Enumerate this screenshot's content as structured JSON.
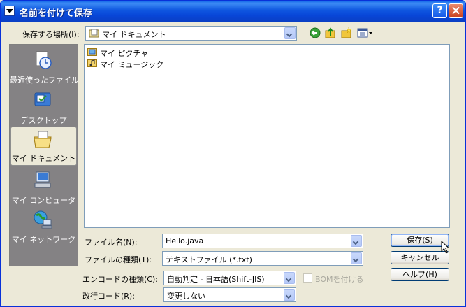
{
  "window": {
    "title": "名前を付けて保存",
    "help_glyph": "?"
  },
  "location": {
    "label": "保存する場所(I):",
    "value": "マイ ドキュメント"
  },
  "toolbar": {
    "back_icon": "back-arrow-icon",
    "up_icon": "up-folder-icon",
    "new_folder_icon": "new-folder-icon",
    "views_icon": "views-menu-icon"
  },
  "places": [
    {
      "label": "最近使ったファイル",
      "icon": "recent-files-icon",
      "selected": false
    },
    {
      "label": "デスクトップ",
      "icon": "desktop-icon",
      "selected": false
    },
    {
      "label": "マイ ドキュメント",
      "icon": "my-documents-icon",
      "selected": true
    },
    {
      "label": "マイ コンピュータ",
      "icon": "my-computer-icon",
      "selected": false
    },
    {
      "label": "マイ ネットワーク",
      "icon": "my-network-icon",
      "selected": false
    }
  ],
  "files": [
    {
      "name": "マイ ピクチャ",
      "icon": "pictures-folder-icon"
    },
    {
      "name": "マイ ミュージック",
      "icon": "music-folder-icon"
    }
  ],
  "form": {
    "filename_label": "ファイル名(N):",
    "filename_value": "Hello.java",
    "filetype_label": "ファイルの種類(T):",
    "filetype_value": "テキストファイル (*.txt)",
    "encoding_label": "エンコードの種類(C):",
    "encoding_value": "自動判定 - 日本語(Shift-JIS)",
    "bom_label": "BOMを付ける",
    "newline_label": "改行コード(R):",
    "newline_value": "変更しない"
  },
  "buttons": {
    "save": "保存(S)",
    "cancel": "キャンセル",
    "help": "ヘルプ(H)"
  },
  "colors": {
    "title_bar": "#0846d8",
    "places_bg": "#848284",
    "dialog_bg": "#ece9d8"
  }
}
